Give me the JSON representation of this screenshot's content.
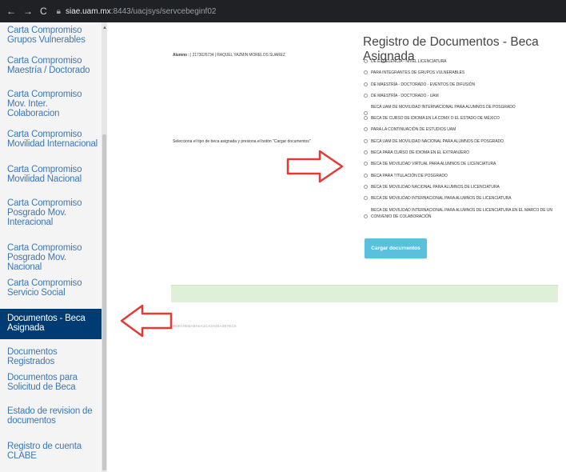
{
  "browser": {
    "url_host": "siae.uam.mx",
    "url_rest": ":8443/uacjsys/servcebeginf02"
  },
  "sidebar": {
    "items": [
      {
        "label": "Carta Compromiso Grupos Vulnerables",
        "active": false
      },
      {
        "label": "Carta Compromiso Maestría / Doctorado",
        "active": false
      },
      {
        "label": "Carta Compromiso Mov. Inter. Colaboracion",
        "active": false
      },
      {
        "label": "Carta Compromiso Movilidad Internacional",
        "active": false
      },
      {
        "label": "Carta Compromiso Movilidad Nacional",
        "active": false
      },
      {
        "label": "Carta Compromiso Posgrado Mov. Interacional",
        "active": false
      },
      {
        "label": "Carta Compromiso Posgrado Mov. Nacional",
        "active": false
      },
      {
        "label": "Carta Compromiso Servicio Social",
        "active": false
      },
      {
        "label": "Documentos - Beca Asignada",
        "active": true
      },
      {
        "label": "Documentos Registrados",
        "active": false
      },
      {
        "label": "Documentos para Solicitud de Beca",
        "active": false
      },
      {
        "label": "Estado de revision de documentos",
        "active": false
      },
      {
        "label": "Registro de cuenta CLABE",
        "active": false
      }
    ]
  },
  "main": {
    "title": "Registro de Documentos - Beca Asignada",
    "alumno_label": "Alumno :",
    "alumno_value": "| 2173026734 | RAQUEL YAZMIN MORELOS SUAREZ",
    "instruction": "Selecciona el tipo de beca asignada y presiona el botón \"Cargar documentos\"",
    "options": [
      "De excelencia - Nivel Licenciatura",
      "Para integrantes de grupos vulnerables",
      "De maestría - Doctorado - Eventos de difusión",
      "De maestría - Doctorado - UAM",
      "Beca UAM de movilidad internacional para alumnos de posgrado",
      "Beca de curso de idioma en la CDMX o el estado de México",
      "Para la continuación de estudios UAM",
      "Beca UAM de movilidad nacional para alumnos de posgrado",
      "Beca para curso de idioma en el extranjero",
      "Beca de movilidad virtual para alumnos de licenciatura",
      "Beca para titulación de posgrado",
      "Beca de movilidad nacional para alumnos de licenciatura",
      "Beca de movilidad internacional para alumnos de licenciatura",
      "Beca de movilidad internacional para alumnos de licenciatura en el marco de un convenio de colaboración"
    ],
    "button_label": "Cargar documentos",
    "footer_code": "BDEC8EBABA6A3CA3A45A4E7EC6"
  },
  "colors": {
    "sidebar_link": "#3d78b8",
    "sidebar_active_bg": "#003b73",
    "button_bg": "#5bc0de",
    "success_bar": "#dff0d8",
    "annotation_arrow": "#e53935"
  }
}
